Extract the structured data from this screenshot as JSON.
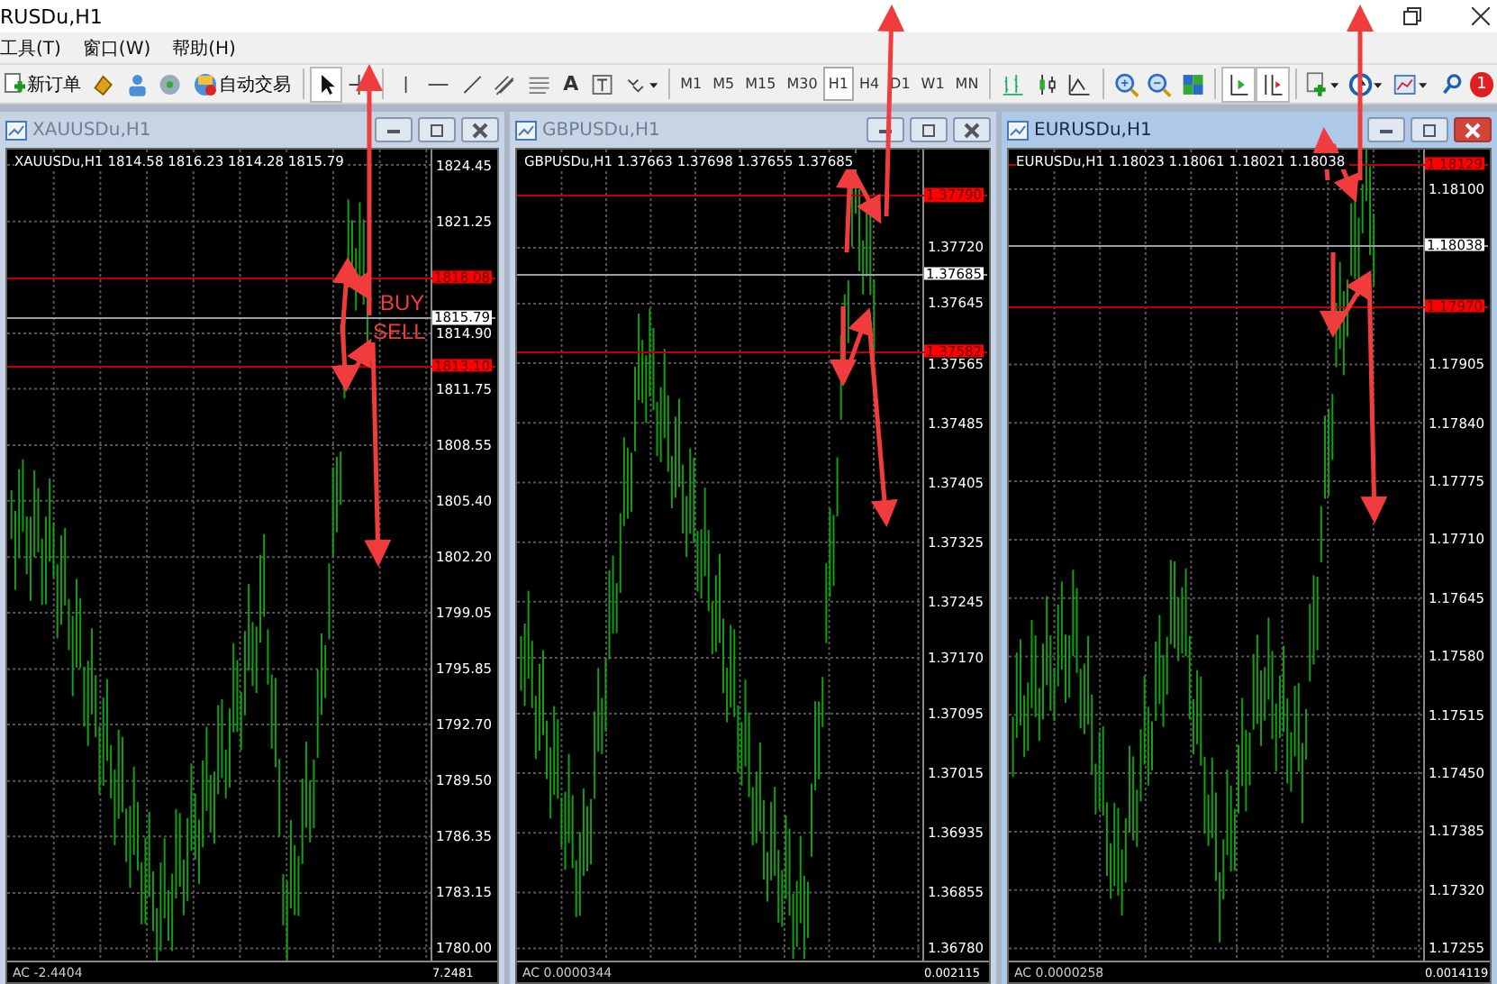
{
  "window": {
    "title": "RUSDu,H1"
  },
  "menu": [
    "工具(T)",
    "窗口(W)",
    "帮助(H)"
  ],
  "toolbar": {
    "new_order": "新订单",
    "auto_trading": "自动交易",
    "text_tool": "A",
    "timeframes": [
      {
        "label": "M1",
        "selected": false
      },
      {
        "label": "M5",
        "selected": false
      },
      {
        "label": "M15",
        "selected": false
      },
      {
        "label": "M30",
        "selected": false
      },
      {
        "label": "H1",
        "selected": true
      },
      {
        "label": "H4",
        "selected": false
      },
      {
        "label": "D1",
        "selected": false
      },
      {
        "label": "W1",
        "selected": false
      },
      {
        "label": "MN",
        "selected": false
      }
    ],
    "notification_count": "1"
  },
  "charts": [
    {
      "title": "XAUUSDu,H1",
      "active": false,
      "header": "XAUUSDu,H1  1814.58 1816.23 1814.28 1815.79",
      "axis_labels": [
        "1824.45",
        "1821.25",
        "1814.90",
        "1811.75",
        "1808.55",
        "1805.40",
        "1802.20",
        "1799.05",
        "1795.85",
        "1792.70",
        "1789.50",
        "1786.35",
        "1783.15",
        "1780.00"
      ],
      "price_tags": [
        {
          "kind": "order",
          "value": "1818.08"
        },
        {
          "kind": "bid",
          "value": "1815.79"
        },
        {
          "kind": "order",
          "value": "1813.10"
        }
      ],
      "annotations": [
        "BUY",
        "SELL"
      ],
      "indicator": {
        "label": "AC -2.4404",
        "scale": "7.2481"
      }
    },
    {
      "title": "GBPUSDu,H1",
      "active": false,
      "header": "GBPUSDu,H1  1.37663 1.37698 1.37655 1.37685",
      "axis_labels": [
        "1.37720",
        "1.37645",
        "1.37565",
        "1.37485",
        "1.37405",
        "1.37325",
        "1.37245",
        "1.37170",
        "1.37095",
        "1.37015",
        "1.36935",
        "1.36855",
        "1.36780"
      ],
      "price_tags": [
        {
          "kind": "order",
          "value": "1.37790"
        },
        {
          "kind": "bid",
          "value": "1.37685"
        },
        {
          "kind": "order",
          "value": "1.37582"
        }
      ],
      "indicator": {
        "label": "AC 0.0000344",
        "scale": "0.002115"
      }
    },
    {
      "title": "EURUSDu,H1",
      "active": true,
      "header": "EURUSDu,H1  1.18023 1.18061 1.18021 1.18038",
      "axis_labels": [
        "1.18100",
        "1.17905",
        "1.17840",
        "1.17775",
        "1.17710",
        "1.17645",
        "1.17580",
        "1.17515",
        "1.17450",
        "1.17385",
        "1.17320",
        "1.17255"
      ],
      "price_tags": [
        {
          "kind": "order",
          "value": "1.18129"
        },
        {
          "kind": "bid",
          "value": "1.18038"
        },
        {
          "kind": "order",
          "value": "1.17970"
        }
      ],
      "indicator": {
        "label": "AC 0.0000258",
        "scale": "0.0014119"
      }
    }
  ]
}
